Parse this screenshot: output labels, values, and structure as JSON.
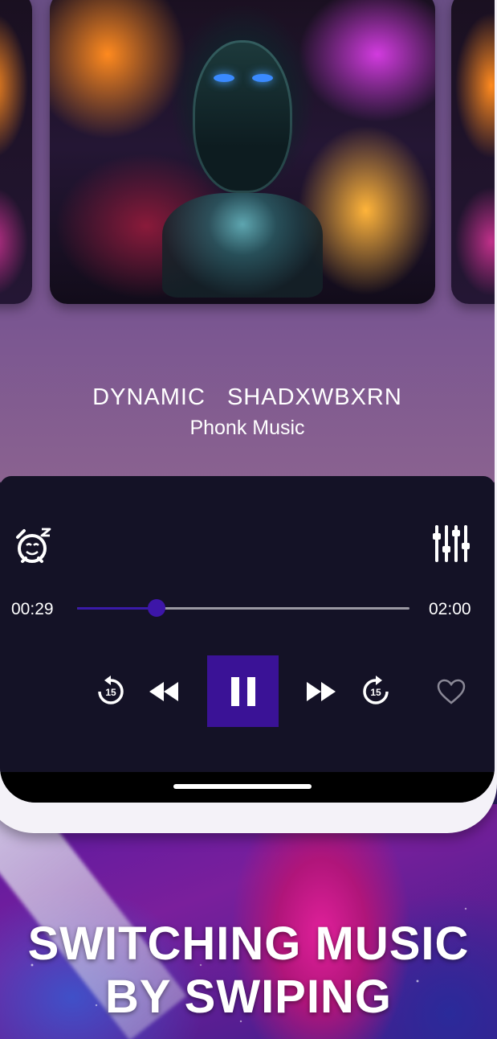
{
  "track": {
    "title": "DYNAMIC   SHADXWBXRN",
    "artist": "Phonk Music"
  },
  "playback": {
    "current_time": "00:29",
    "total_time": "02:00",
    "progress_fraction": 0.24
  },
  "controls": {
    "replay_seconds": "15",
    "forward_seconds": "15"
  },
  "promo": {
    "line1": "SWITCHING MUSIC",
    "line2": "BY SWIPING"
  },
  "icons": {
    "sleep_timer": "alarm-sleep-icon",
    "equalizer": "equalizer-icon",
    "replay": "replay-15-icon",
    "rewind": "rewind-icon",
    "pause": "pause-icon",
    "fast_forward": "fast-forward-icon",
    "forward": "forward-15-icon",
    "favorite": "heart-outline-icon"
  },
  "colors": {
    "panel_bg": "#141226",
    "accent": "#3a1296",
    "seek_thumb": "#3d16a8",
    "text": "#ffffff"
  }
}
